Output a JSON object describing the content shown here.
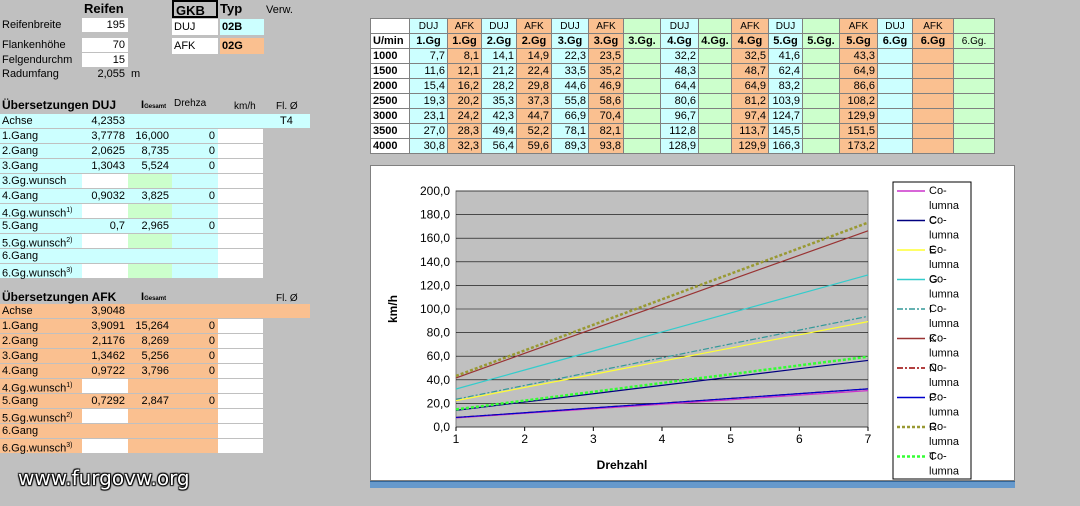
{
  "tires": {
    "header": "Reifen",
    "rows": [
      {
        "label": "Reifenbreite",
        "value": "195"
      },
      {
        "label": "Flankenhöhe",
        "value": "70"
      },
      {
        "label": "Felgendurchm",
        "value": "15"
      },
      {
        "label": "Radumfang",
        "value": "2,055",
        "unit": "m"
      }
    ]
  },
  "gkb": {
    "header": "GKB",
    "typ_header": "Typ",
    "verw_header": "Verw.",
    "rows": [
      {
        "label": "DUJ",
        "typ": "02B"
      },
      {
        "label": "AFK",
        "typ": "02G"
      }
    ]
  },
  "duj": {
    "title": "Übersetzungen DUJ",
    "col_i": "I",
    "col_i_sub": "Gesamt",
    "col_drehzahl": "Drehza",
    "col_kmh": "km/h",
    "col_fl": "Fl. Ø",
    "fl_value": "T4",
    "rows": [
      {
        "label": "Achse",
        "ratio": "4,2353",
        "total": "",
        "drehzahl": ""
      },
      {
        "label": "1.Gang",
        "ratio": "3,7778",
        "total": "16,000",
        "drehzahl": "0"
      },
      {
        "label": "2.Gang",
        "ratio": "2,0625",
        "total": "8,735",
        "drehzahl": "0"
      },
      {
        "label": "3.Gang",
        "ratio": "1,3043",
        "total": "5,524",
        "drehzahl": "0"
      },
      {
        "label": "3.Gg.wunsch",
        "sup": "",
        "ratio": "",
        "total": "",
        "drehzahl": ""
      },
      {
        "label": "4.Gang",
        "ratio": "0,9032",
        "total": "3,825",
        "drehzahl": "0"
      },
      {
        "label": "4.Gg.wunsch",
        "sup": "1)",
        "ratio": "",
        "total": "",
        "drehzahl": ""
      },
      {
        "label": "5.Gang",
        "ratio": "0,7",
        "total": "2,965",
        "drehzahl": "0"
      },
      {
        "label": "5.Gg.wunsch",
        "sup": "2)",
        "ratio": "",
        "total": "",
        "drehzahl": ""
      },
      {
        "label": "6.Gang",
        "ratio": "",
        "total": "",
        "drehzahl": ""
      },
      {
        "label": "6.Gg.wunsch",
        "sup": "3)",
        "ratio": "",
        "total": "",
        "drehzahl": ""
      }
    ]
  },
  "afk": {
    "title": "Übersetzungen AFK",
    "col_i": "I",
    "col_i_sub": "Gesamt",
    "col_fl": "Fl. Ø",
    "rows": [
      {
        "label": "Achse",
        "ratio": "3,9048",
        "total": "",
        "drehzahl": ""
      },
      {
        "label": "1.Gang",
        "ratio": "3,9091",
        "total": "15,264",
        "drehzahl": "0"
      },
      {
        "label": "2.Gang",
        "ratio": "2,1176",
        "total": "8,269",
        "drehzahl": "0"
      },
      {
        "label": "3.Gang",
        "ratio": "1,3462",
        "total": "5,256",
        "drehzahl": "0"
      },
      {
        "label": "4.Gang",
        "ratio": "0,9722",
        "total": "3,796",
        "drehzahl": "0"
      },
      {
        "label": "4.Gg.wunsch",
        "sup": "1)",
        "ratio": "",
        "total": "",
        "drehzahl": ""
      },
      {
        "label": "5.Gang",
        "ratio": "0,7292",
        "total": "2,847",
        "drehzahl": "0"
      },
      {
        "label": "5.Gg.wunsch",
        "sup": "2)",
        "ratio": "",
        "total": "",
        "drehzahl": ""
      },
      {
        "label": "6.Gang",
        "ratio": "",
        "total": "",
        "drehzahl": ""
      },
      {
        "label": "6.Gg.wunsch",
        "sup": "3)",
        "ratio": "",
        "total": "",
        "drehzahl": ""
      }
    ]
  },
  "speed_table": {
    "top_row": [
      "DUJ",
      "AFK",
      "DUJ",
      "AFK",
      "DUJ",
      "AFK",
      "",
      "DUJ",
      "",
      "AFK",
      "DUJ",
      "",
      "AFK",
      "DUJ",
      "AFK",
      ""
    ],
    "header_first": "U/min",
    "headers": [
      "1.Gg",
      "1.Gg",
      "2.Gg",
      "2.Gg",
      "3.Gg",
      "3.Gg",
      "3.Gg.",
      "4.Gg",
      "4.Gg.",
      "4.Gg",
      "5.Gg",
      "5.Gg.",
      "5.Gg",
      "6.Gg",
      "6.Gg",
      "6.Gg."
    ],
    "rows": [
      {
        "rpm": "1000",
        "v": [
          "7,7",
          "8,1",
          "14,1",
          "14,9",
          "22,3",
          "23,5",
          "",
          "32,2",
          "",
          "32,5",
          "41,6",
          "",
          "43,3",
          "",
          "",
          ""
        ]
      },
      {
        "rpm": "1500",
        "v": [
          "11,6",
          "12,1",
          "21,2",
          "22,4",
          "33,5",
          "35,2",
          "",
          "48,3",
          "",
          "48,7",
          "62,4",
          "",
          "64,9",
          "",
          "",
          ""
        ]
      },
      {
        "rpm": "2000",
        "v": [
          "15,4",
          "16,2",
          "28,2",
          "29,8",
          "44,6",
          "46,9",
          "",
          "64,4",
          "",
          "64,9",
          "83,2",
          "",
          "86,6",
          "",
          "",
          ""
        ]
      },
      {
        "rpm": "2500",
        "v": [
          "19,3",
          "20,2",
          "35,3",
          "37,3",
          "55,8",
          "58,6",
          "",
          "80,6",
          "",
          "81,2",
          "103,9",
          "",
          "108,2",
          "",
          "",
          ""
        ]
      },
      {
        "rpm": "3000",
        "v": [
          "23,1",
          "24,2",
          "42,3",
          "44,7",
          "66,9",
          "70,4",
          "",
          "96,7",
          "",
          "97,4",
          "124,7",
          "",
          "129,9",
          "",
          "",
          ""
        ]
      },
      {
        "rpm": "3500",
        "v": [
          "27,0",
          "28,3",
          "49,4",
          "52,2",
          "78,1",
          "82,1",
          "",
          "112,8",
          "",
          "113,7",
          "145,5",
          "",
          "151,5",
          "",
          "",
          ""
        ]
      },
      {
        "rpm": "4000",
        "v": [
          "30,8",
          "32,3",
          "56,4",
          "59,6",
          "89,3",
          "93,8",
          "",
          "128,9",
          "",
          "129,9",
          "166,3",
          "",
          "173,2",
          "",
          "",
          ""
        ]
      }
    ]
  },
  "chart_data": {
    "type": "line",
    "title": "",
    "xlabel": "Drehzahl",
    "ylabel": "km/h",
    "x": [
      1,
      2,
      3,
      4,
      5,
      6,
      7
    ],
    "xlim": [
      1,
      7
    ],
    "ylim": [
      0,
      200
    ],
    "yticks": [
      "0,0",
      "20,0",
      "40,0",
      "60,0",
      "80,0",
      "100,0",
      "120,0",
      "140,0",
      "160,0",
      "180,0",
      "200,0"
    ],
    "grid": true,
    "legend": "right",
    "legend_entries": [
      "Co-\nlumna\nC",
      "Co-\nlumna\nE",
      "Co-\nlumna\nG",
      "Co-\nlumna\nI",
      "Co-\nlumna\nK",
      "Co-\nlumna\nN",
      "Co-\nlumna\nP",
      "Co-\nlumna\nR",
      "Co-\nlumna\nT",
      "Co-\nlumna\nW"
    ],
    "series": [
      {
        "color": "#cc33cc",
        "dash": "solid",
        "values": [
          7.7,
          11.6,
          15.4,
          19.3,
          23.1,
          27.0,
          30.8
        ]
      },
      {
        "color": "#000080",
        "dash": "solid",
        "values": [
          14.1,
          21.2,
          28.2,
          35.3,
          42.3,
          49.4,
          56.4
        ]
      },
      {
        "color": "#ffff33",
        "dash": "solid",
        "values": [
          22.3,
          33.5,
          44.6,
          55.8,
          66.9,
          78.1,
          89.3
        ]
      },
      {
        "color": "#33cccc",
        "dash": "solid",
        "values": [
          32.2,
          48.3,
          64.4,
          80.6,
          96.7,
          112.8,
          128.9
        ]
      },
      {
        "color": "#339999",
        "dash": "dashdot",
        "values": [
          23.5,
          35.2,
          46.9,
          58.6,
          70.4,
          82.1,
          93.8
        ]
      },
      {
        "color": "#993333",
        "dash": "solid",
        "values": [
          41.6,
          62.4,
          83.2,
          103.9,
          124.7,
          145.5,
          166.3
        ]
      },
      {
        "color": "#990000",
        "dash": "dashdot",
        "values": [
          8.1,
          12.1,
          16.2,
          20.2,
          24.2,
          28.3,
          32.3
        ]
      },
      {
        "color": "#0000cc",
        "dash": "solid",
        "values": [
          8.1,
          12.1,
          16.2,
          20.2,
          24.2,
          28.3,
          32.3
        ]
      },
      {
        "color": "#999933",
        "dash": "dot",
        "values": [
          43.3,
          64.9,
          86.6,
          108.2,
          129.9,
          151.5,
          173.2
        ]
      },
      {
        "color": "#33ff33",
        "dash": "dot",
        "values": [
          14.9,
          22.4,
          29.8,
          37.3,
          44.7,
          52.2,
          59.6
        ]
      }
    ]
  },
  "watermark": "www.furgovw.org"
}
